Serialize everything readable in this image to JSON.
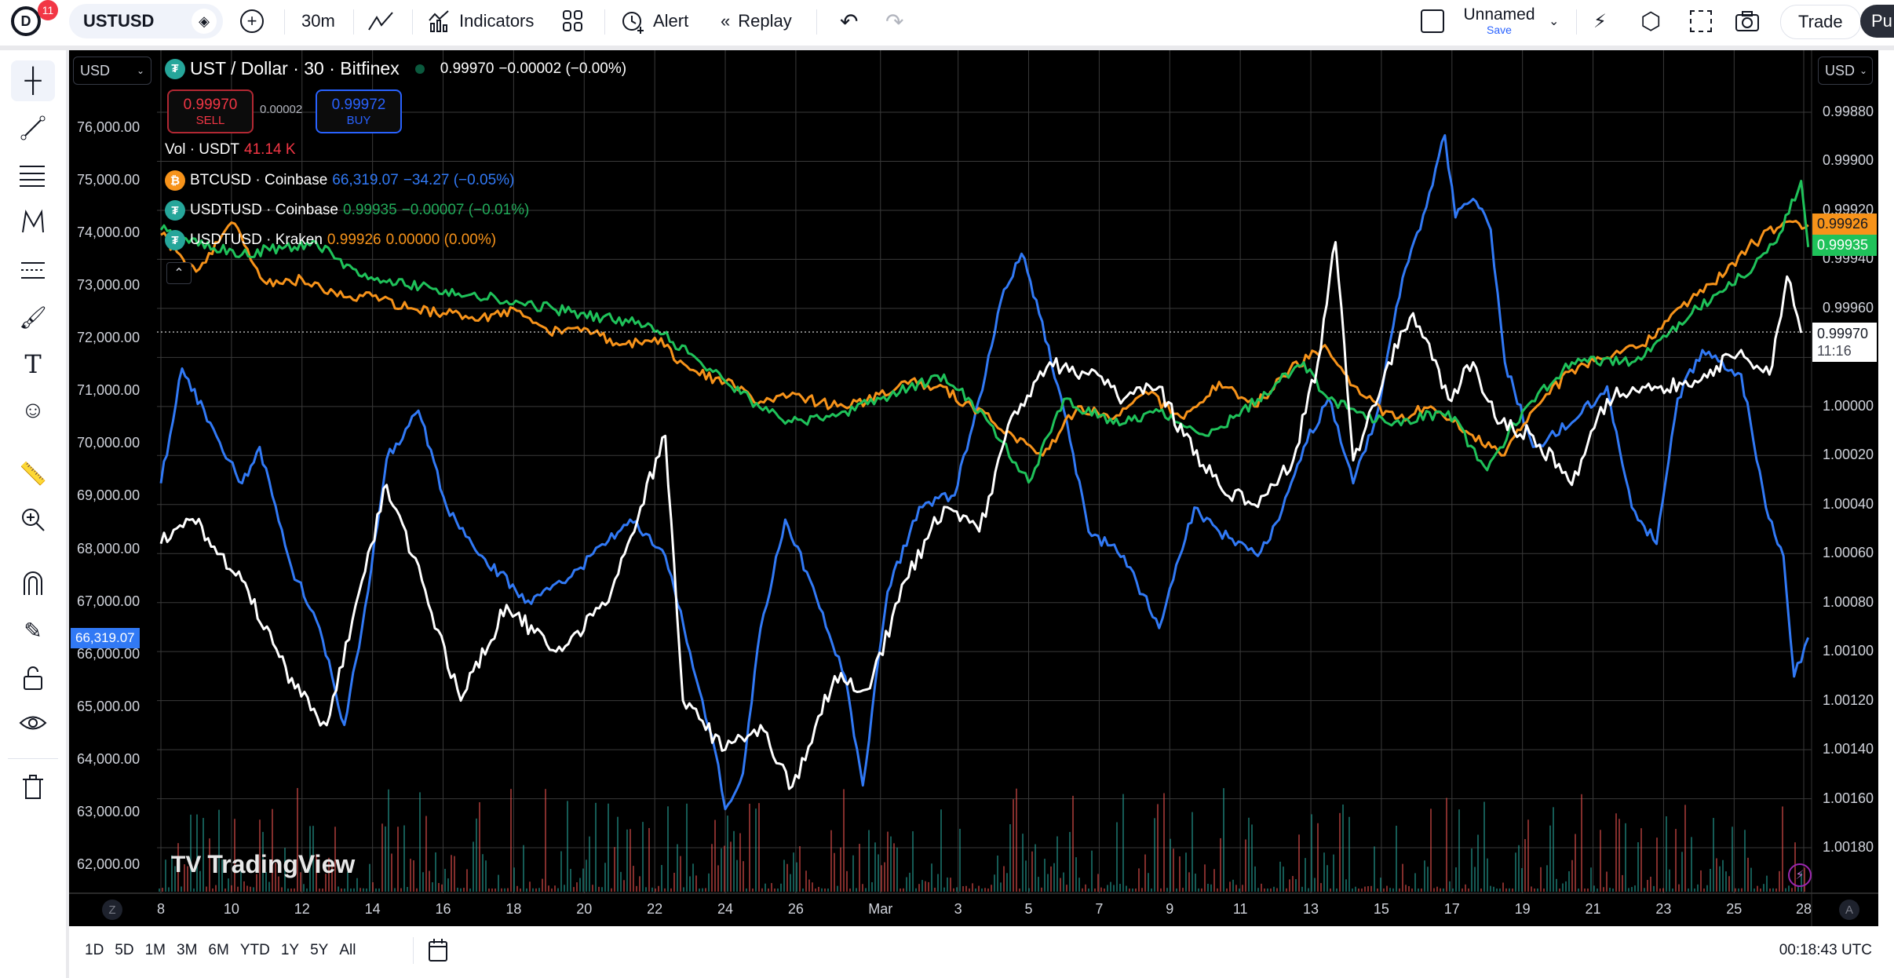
{
  "topbar": {
    "notification_count": "11",
    "symbol": "USTUSD",
    "interval": "30m",
    "indicators_label": "Indicators",
    "alert_label": "Alert",
    "replay_label": "Replay",
    "layout_name": "Unnamed",
    "save_label": "Save",
    "trade_label": "Trade",
    "publish_label": "Pu"
  },
  "chart": {
    "left_currency": "USD",
    "right_currency": "USD",
    "title": "UST / Dollar · 30 · Bitfinex",
    "last": "0.99970",
    "change": "−0.00002 (−0.00%)",
    "sell_price": "0.99970",
    "sell_label": "SELL",
    "spread": "0.00002",
    "buy_price": "0.99972",
    "buy_label": "BUY",
    "volume_label": "Vol · USDT",
    "volume_value": "41.14 K",
    "compare": [
      {
        "name": "BTCUSD · Coinbase",
        "value": "66,319.07",
        "change": "−34.27 (−0.05%)",
        "color": "#3179f5"
      },
      {
        "name": "USDTUSD · Coinbase",
        "value": "0.99935",
        "change": "−0.00007 (−0.01%)",
        "color": "#22ab5a"
      },
      {
        "name": "USDTUSD · Kraken",
        "value": "0.99926",
        "change": "0.00000 (0.00%)",
        "color": "#f7931a"
      }
    ],
    "watermark": "TradingView",
    "countdown": "11:16",
    "z_label": "Z",
    "a_label": "A",
    "colors": {
      "btc": "#3179f5",
      "usdt_coinbase": "#1fc25a",
      "usdt_kraken": "#f7931a",
      "ust": "#ffffff",
      "vol_up": "#26a69a",
      "vol_down": "#ef5350"
    }
  },
  "chart_data": {
    "type": "line",
    "left_axis": {
      "ticks": [
        "76,000.00",
        "75,000.00",
        "74,000.00",
        "73,000.00",
        "72,000.00",
        "71,000.00",
        "70,000.00",
        "69,000.00",
        "68,000.00",
        "67,000.00",
        "66,000.00",
        "65,000.00",
        "64,000.00",
        "63,000.00",
        "62,000.00"
      ],
      "range": [
        62000,
        76000
      ]
    },
    "right_axis": {
      "ticks": [
        "0.99880",
        "0.99900",
        "0.99920",
        "0.99940",
        "0.99960",
        "0.99980",
        "1.00000",
        "1.00020",
        "1.00040",
        "1.00060",
        "1.00080",
        "1.00100",
        "1.00120",
        "1.00140",
        "1.00160",
        "1.00180"
      ],
      "range": [
        0.9988,
        1.0018
      ],
      "inverted": true
    },
    "x_ticks": [
      {
        "label": "8",
        "day": 0
      },
      {
        "label": "10",
        "day": 2
      },
      {
        "label": "12",
        "day": 4
      },
      {
        "label": "14",
        "day": 6
      },
      {
        "label": "16",
        "day": 8
      },
      {
        "label": "18",
        "day": 10
      },
      {
        "label": "20",
        "day": 12
      },
      {
        "label": "22",
        "day": 14
      },
      {
        "label": "24",
        "day": 16
      },
      {
        "label": "26",
        "day": 18
      },
      {
        "label": "Mar",
        "day": 20.4
      },
      {
        "label": "3",
        "day": 22.6
      },
      {
        "label": "5",
        "day": 24.6
      },
      {
        "label": "7",
        "day": 26.6
      },
      {
        "label": "9",
        "day": 28.6
      },
      {
        "label": "11",
        "day": 30.6
      },
      {
        "label": "13",
        "day": 32.6
      },
      {
        "label": "15",
        "day": 34.6
      },
      {
        "label": "17",
        "day": 36.6
      },
      {
        "label": "19",
        "day": 38.6
      },
      {
        "label": "21",
        "day": 40.6
      },
      {
        "label": "23",
        "day": 42.6
      },
      {
        "label": "25",
        "day": 44.6
      },
      {
        "label": "28",
        "day": 46.6
      }
    ],
    "series": [
      {
        "name": "BTCUSD · Coinbase",
        "axis": "left",
        "color": "#3179f5",
        "last_label": "66,319.07",
        "points": [
          [
            0,
            69250
          ],
          [
            0.6,
            71430
          ],
          [
            1.4,
            70400
          ],
          [
            2.3,
            69250
          ],
          [
            2.8,
            69940
          ],
          [
            3.7,
            67650
          ],
          [
            4.5,
            66500
          ],
          [
            5.2,
            64660
          ],
          [
            5.7,
            66500
          ],
          [
            6.4,
            69710
          ],
          [
            7.3,
            70630
          ],
          [
            8.1,
            68800
          ],
          [
            9.1,
            67870
          ],
          [
            10.5,
            66960
          ],
          [
            11.9,
            67650
          ],
          [
            13.3,
            68560
          ],
          [
            14.3,
            67870
          ],
          [
            15.0,
            66040
          ],
          [
            15.7,
            64200
          ],
          [
            16.0,
            63060
          ],
          [
            16.5,
            63740
          ],
          [
            17.0,
            66500
          ],
          [
            17.7,
            68560
          ],
          [
            18.4,
            67420
          ],
          [
            19.4,
            65580
          ],
          [
            19.9,
            63510
          ],
          [
            20.6,
            67190
          ],
          [
            21.5,
            68800
          ],
          [
            22.5,
            69020
          ],
          [
            23.2,
            70860
          ],
          [
            23.9,
            72930
          ],
          [
            24.4,
            73610
          ],
          [
            24.9,
            72470
          ],
          [
            25.6,
            70630
          ],
          [
            26.3,
            68330
          ],
          [
            27.3,
            67870
          ],
          [
            28.3,
            66500
          ],
          [
            28.7,
            67420
          ],
          [
            29.3,
            68790
          ],
          [
            30.0,
            68330
          ],
          [
            31.1,
            67870
          ],
          [
            31.7,
            68560
          ],
          [
            32.4,
            69940
          ],
          [
            33.1,
            70860
          ],
          [
            33.8,
            69250
          ],
          [
            34.5,
            70630
          ],
          [
            35.2,
            73150
          ],
          [
            35.7,
            74070
          ],
          [
            36.4,
            75860
          ],
          [
            36.7,
            74300
          ],
          [
            37.2,
            74650
          ],
          [
            37.7,
            74070
          ],
          [
            38.1,
            71550
          ],
          [
            38.9,
            69940
          ],
          [
            40.0,
            70400
          ],
          [
            41.0,
            71090
          ],
          [
            41.7,
            68790
          ],
          [
            42.4,
            68100
          ],
          [
            43.0,
            70860
          ],
          [
            43.7,
            71780
          ],
          [
            44.8,
            71320
          ],
          [
            45.5,
            68790
          ],
          [
            46.0,
            67870
          ],
          [
            46.3,
            65580
          ],
          [
            46.7,
            66319
          ]
        ]
      },
      {
        "name": "USDTUSD · Kraken",
        "axis": "right",
        "color": "#f7931a",
        "last_label": "0.99926",
        "points": [
          [
            0,
            0.9993
          ],
          [
            1.0,
            0.99945
          ],
          [
            2.0,
            0.99925
          ],
          [
            3.0,
            0.9995
          ],
          [
            4.0,
            0.99948
          ],
          [
            5.0,
            0.99955
          ],
          [
            6.0,
            0.99955
          ],
          [
            7.0,
            0.9996
          ],
          [
            8.0,
            0.99962
          ],
          [
            9.0,
            0.99965
          ],
          [
            10.0,
            0.9996
          ],
          [
            11.0,
            0.9997
          ],
          [
            12.0,
            0.99968
          ],
          [
            13.0,
            0.99975
          ],
          [
            14.0,
            0.99972
          ],
          [
            15.0,
            0.99985
          ],
          [
            16.0,
            0.9999
          ],
          [
            17.0,
            0.99998
          ],
          [
            18.0,
            0.99995
          ],
          [
            19.0,
            1.0
          ],
          [
            20.0,
            0.99998
          ],
          [
            21.0,
            0.9999
          ],
          [
            22.0,
            0.99992
          ],
          [
            23.0,
            1.0
          ],
          [
            24.0,
            1.0001
          ],
          [
            25.0,
            1.0002
          ],
          [
            26.0,
            1.0
          ],
          [
            27.0,
            1.00005
          ],
          [
            28.0,
            0.99995
          ],
          [
            29.0,
            1.00005
          ],
          [
            30.0,
            0.9999
          ],
          [
            31.0,
            1.0
          ],
          [
            32.0,
            0.99985
          ],
          [
            33.0,
            0.99975
          ],
          [
            34.0,
            0.99995
          ],
          [
            35.0,
            1.00005
          ],
          [
            36.0,
            1.0
          ],
          [
            37.0,
            1.0001
          ],
          [
            38.0,
            1.0002
          ],
          [
            39.0,
            1.0
          ],
          [
            40.0,
            0.99985
          ],
          [
            41.0,
            0.9998
          ],
          [
            42.0,
            0.99975
          ],
          [
            43.0,
            0.9996
          ],
          [
            44.0,
            0.9995
          ],
          [
            45.0,
            0.99935
          ],
          [
            46.0,
            0.99925
          ],
          [
            46.7,
            0.99926
          ]
        ]
      },
      {
        "name": "USDTUSD · Coinbase",
        "axis": "right",
        "color": "#1fc25a",
        "last_label": "0.99935",
        "points": [
          [
            0,
            0.99928
          ],
          [
            2.3,
            0.99938
          ],
          [
            4.4,
            0.99933
          ],
          [
            5.7,
            0.99947
          ],
          [
            7.8,
            0.99952
          ],
          [
            9.8,
            0.99957
          ],
          [
            11.9,
            0.99962
          ],
          [
            13.9,
            0.99967
          ],
          [
            15.3,
            0.99982
          ],
          [
            16.7,
            0.99997
          ],
          [
            17.7,
            1.00007
          ],
          [
            19.4,
            1.00002
          ],
          [
            20.4,
            0.99997
          ],
          [
            22.2,
            0.99987
          ],
          [
            23.5,
            1.00007
          ],
          [
            24.6,
            1.00031
          ],
          [
            25.6,
            0.99997
          ],
          [
            27.0,
            1.00007
          ],
          [
            28.3,
            1.00002
          ],
          [
            29.7,
            1.00012
          ],
          [
            31.1,
            0.99997
          ],
          [
            32.4,
            0.99982
          ],
          [
            33.1,
            0.99997
          ],
          [
            34.8,
            1.00007
          ],
          [
            36.5,
            1.00002
          ],
          [
            37.6,
            1.00026
          ],
          [
            38.6,
            1.00002
          ],
          [
            40.0,
            0.99982
          ],
          [
            41.7,
            0.99982
          ],
          [
            43.4,
            0.99962
          ],
          [
            44.8,
            0.99947
          ],
          [
            45.8,
            0.99933
          ],
          [
            46.5,
            0.99908
          ],
          [
            46.7,
            0.99935
          ]
        ]
      },
      {
        "name": "UST / Dollar · 30 · Bitfinex",
        "axis": "right",
        "color": "#ffffff",
        "last_label": "0.99970",
        "points": [
          [
            0,
            1.00056
          ],
          [
            0.9,
            1.00046
          ],
          [
            2.3,
            1.00071
          ],
          [
            3.8,
            1.00115
          ],
          [
            4.7,
            1.0013
          ],
          [
            5.7,
            1.00071
          ],
          [
            6.4,
            1.00032
          ],
          [
            7.4,
            1.00071
          ],
          [
            8.5,
            1.0012
          ],
          [
            9.8,
            1.00081
          ],
          [
            11.2,
            1.001
          ],
          [
            12.6,
            1.00081
          ],
          [
            13.6,
            1.00041
          ],
          [
            14.3,
            1.00012
          ],
          [
            14.8,
            1.0012
          ],
          [
            16.0,
            1.0014
          ],
          [
            17.0,
            1.0013
          ],
          [
            17.9,
            1.00155
          ],
          [
            19.1,
            1.0011
          ],
          [
            20.1,
            1.00115
          ],
          [
            21.1,
            1.00071
          ],
          [
            22.2,
            1.00041
          ],
          [
            23.2,
            1.00051
          ],
          [
            24.2,
            1.00002
          ],
          [
            25.2,
            0.99982
          ],
          [
            26.3,
            0.99987
          ],
          [
            27.3,
            0.99997
          ],
          [
            28.3,
            0.99992
          ],
          [
            29.0,
            1.00012
          ],
          [
            30.0,
            1.00032
          ],
          [
            31.1,
            1.00041
          ],
          [
            32.1,
            1.00022
          ],
          [
            32.8,
            0.99982
          ],
          [
            33.3,
            0.99933
          ],
          [
            33.8,
            1.00022
          ],
          [
            34.8,
            0.99982
          ],
          [
            35.5,
            0.99962
          ],
          [
            36.5,
            0.99997
          ],
          [
            37.2,
            0.99982
          ],
          [
            37.9,
            1.00007
          ],
          [
            38.9,
            1.00012
          ],
          [
            40.0,
            1.00032
          ],
          [
            41.0,
            0.99997
          ],
          [
            42.0,
            0.99992
          ],
          [
            43.4,
            0.99992
          ],
          [
            44.8,
            0.99977
          ],
          [
            45.6,
            0.99987
          ],
          [
            46.1,
            0.99947
          ],
          [
            46.5,
            0.9997
          ]
        ]
      }
    ]
  },
  "bottombar": {
    "ranges": [
      "1D",
      "5D",
      "1M",
      "3M",
      "6M",
      "YTD",
      "1Y",
      "5Y",
      "All"
    ],
    "clock": "00:18:43 UTC"
  }
}
